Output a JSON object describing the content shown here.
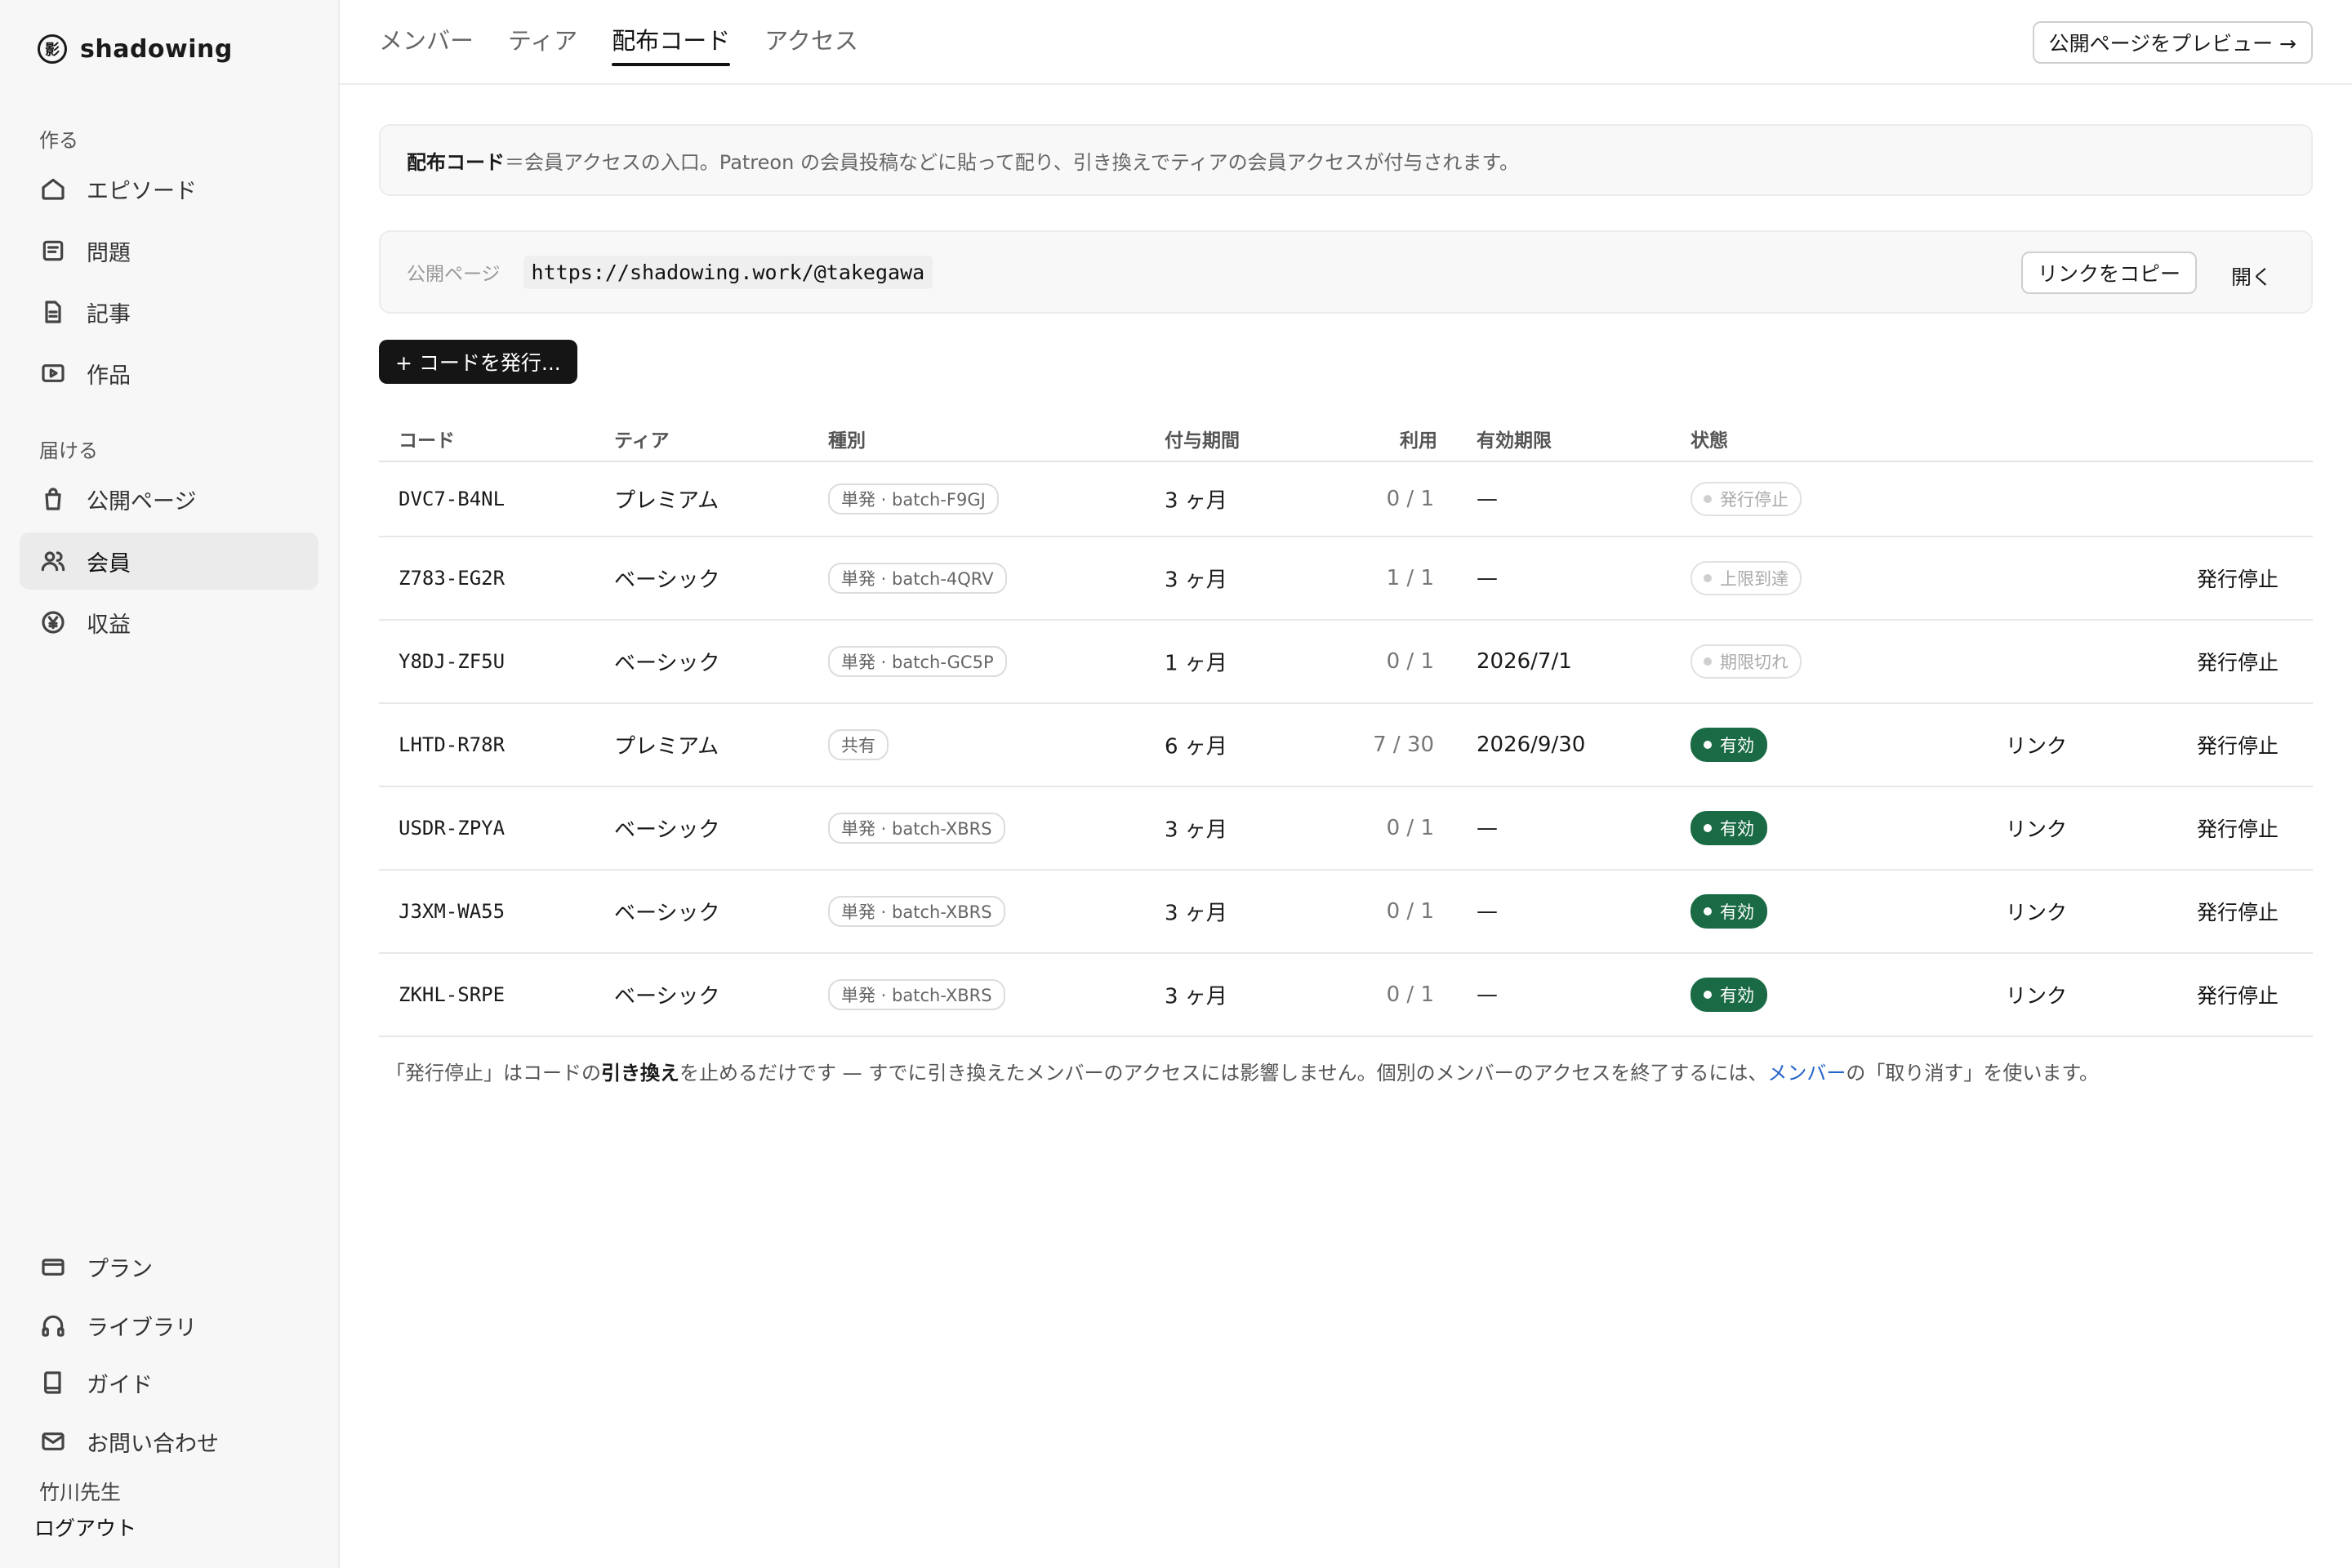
{
  "brand": {
    "mark": "影",
    "name": "shadowing"
  },
  "sidebar": {
    "section_create": "作る",
    "section_deliver": "届ける",
    "create_items": [
      {
        "label": "エピソード",
        "icon": "home-icon"
      },
      {
        "label": "問題",
        "icon": "list-icon"
      },
      {
        "label": "記事",
        "icon": "document-icon"
      },
      {
        "label": "作品",
        "icon": "play-icon"
      }
    ],
    "deliver_items": [
      {
        "label": "公開ページ",
        "icon": "bag-icon"
      },
      {
        "label": "会員",
        "icon": "users-icon"
      },
      {
        "label": "収益",
        "icon": "yen-icon"
      }
    ],
    "bottom_items": [
      {
        "label": "プラン",
        "icon": "card-icon"
      },
      {
        "label": "ライブラリ",
        "icon": "headphones-icon"
      },
      {
        "label": "ガイド",
        "icon": "book-icon"
      },
      {
        "label": "お問い合わせ",
        "icon": "mail-icon"
      }
    ],
    "user_name": "竹川先生",
    "logout": "ログアウト"
  },
  "tabs": [
    "メンバー",
    "ティア",
    "配布コード",
    "アクセス"
  ],
  "active_tab": "配布コード",
  "preview_button": "公開ページをプレビュー →",
  "info": {
    "bold": "配布コード",
    "text": "＝会員アクセスの入口。Patreon の会員投稿などに貼って配り、引き換えでティアの会員アクセスが付与されます。"
  },
  "public_page": {
    "label": "公開ページ",
    "url": "https://shadowing.work/@takegawa",
    "copy": "リンクをコピー",
    "open": "開く"
  },
  "issue_button": "+ コードを発行...",
  "table": {
    "headers": [
      "コード",
      "ティア",
      "種別",
      "付与期間",
      "利用",
      "有効期限",
      "状態"
    ],
    "rows": [
      {
        "code": "DVC7-B4NL",
        "tier": "プレミアム",
        "kind": "単発 · batch-F9GJ",
        "period": "3 ヶ月",
        "usage": "0 / 1",
        "expiry": "—",
        "status": "発行停止",
        "active": false,
        "link": "",
        "action": ""
      },
      {
        "code": "Z783-EG2R",
        "tier": "ベーシック",
        "kind": "単発 · batch-4QRV",
        "period": "3 ヶ月",
        "usage": "1 / 1",
        "expiry": "—",
        "status": "上限到達",
        "active": false,
        "link": "",
        "action": "発行停止"
      },
      {
        "code": "Y8DJ-ZF5U",
        "tier": "ベーシック",
        "kind": "単発 · batch-GC5P",
        "period": "1 ヶ月",
        "usage": "0 / 1",
        "expiry": "2026/7/1",
        "status": "期限切れ",
        "active": false,
        "link": "",
        "action": "発行停止"
      },
      {
        "code": "LHTD-R78R",
        "tier": "プレミアム",
        "kind": "共有",
        "period": "6 ヶ月",
        "usage": "7 / 30",
        "expiry": "2026/9/30",
        "status": "有効",
        "active": true,
        "link": "リンク",
        "action": "発行停止"
      },
      {
        "code": "USDR-ZPYA",
        "tier": "ベーシック",
        "kind": "単発 · batch-XBRS",
        "period": "3 ヶ月",
        "usage": "0 / 1",
        "expiry": "—",
        "status": "有効",
        "active": true,
        "link": "リンク",
        "action": "発行停止"
      },
      {
        "code": "J3XM-WA55",
        "tier": "ベーシック",
        "kind": "単発 · batch-XBRS",
        "period": "3 ヶ月",
        "usage": "0 / 1",
        "expiry": "—",
        "status": "有効",
        "active": true,
        "link": "リンク",
        "action": "発行停止"
      },
      {
        "code": "ZKHL-SRPE",
        "tier": "ベーシック",
        "kind": "単発 · batch-XBRS",
        "period": "3 ヶ月",
        "usage": "0 / 1",
        "expiry": "—",
        "status": "有効",
        "active": true,
        "link": "リンク",
        "action": "発行停止"
      }
    ]
  },
  "footnote": {
    "part1": "「発行停止」はコードの",
    "bold": "引き換え",
    "part2": "を止めるだけです — すでに引き換えたメンバーのアクセスには影響しません。個別のメンバーのアクセスを終了するには、",
    "link": "メンバー",
    "part3": "の「取り消す」を使います。"
  },
  "colors": {
    "accent_green": "#1a6b45",
    "link_blue": "#2463c7",
    "dark_button": "#151515"
  }
}
